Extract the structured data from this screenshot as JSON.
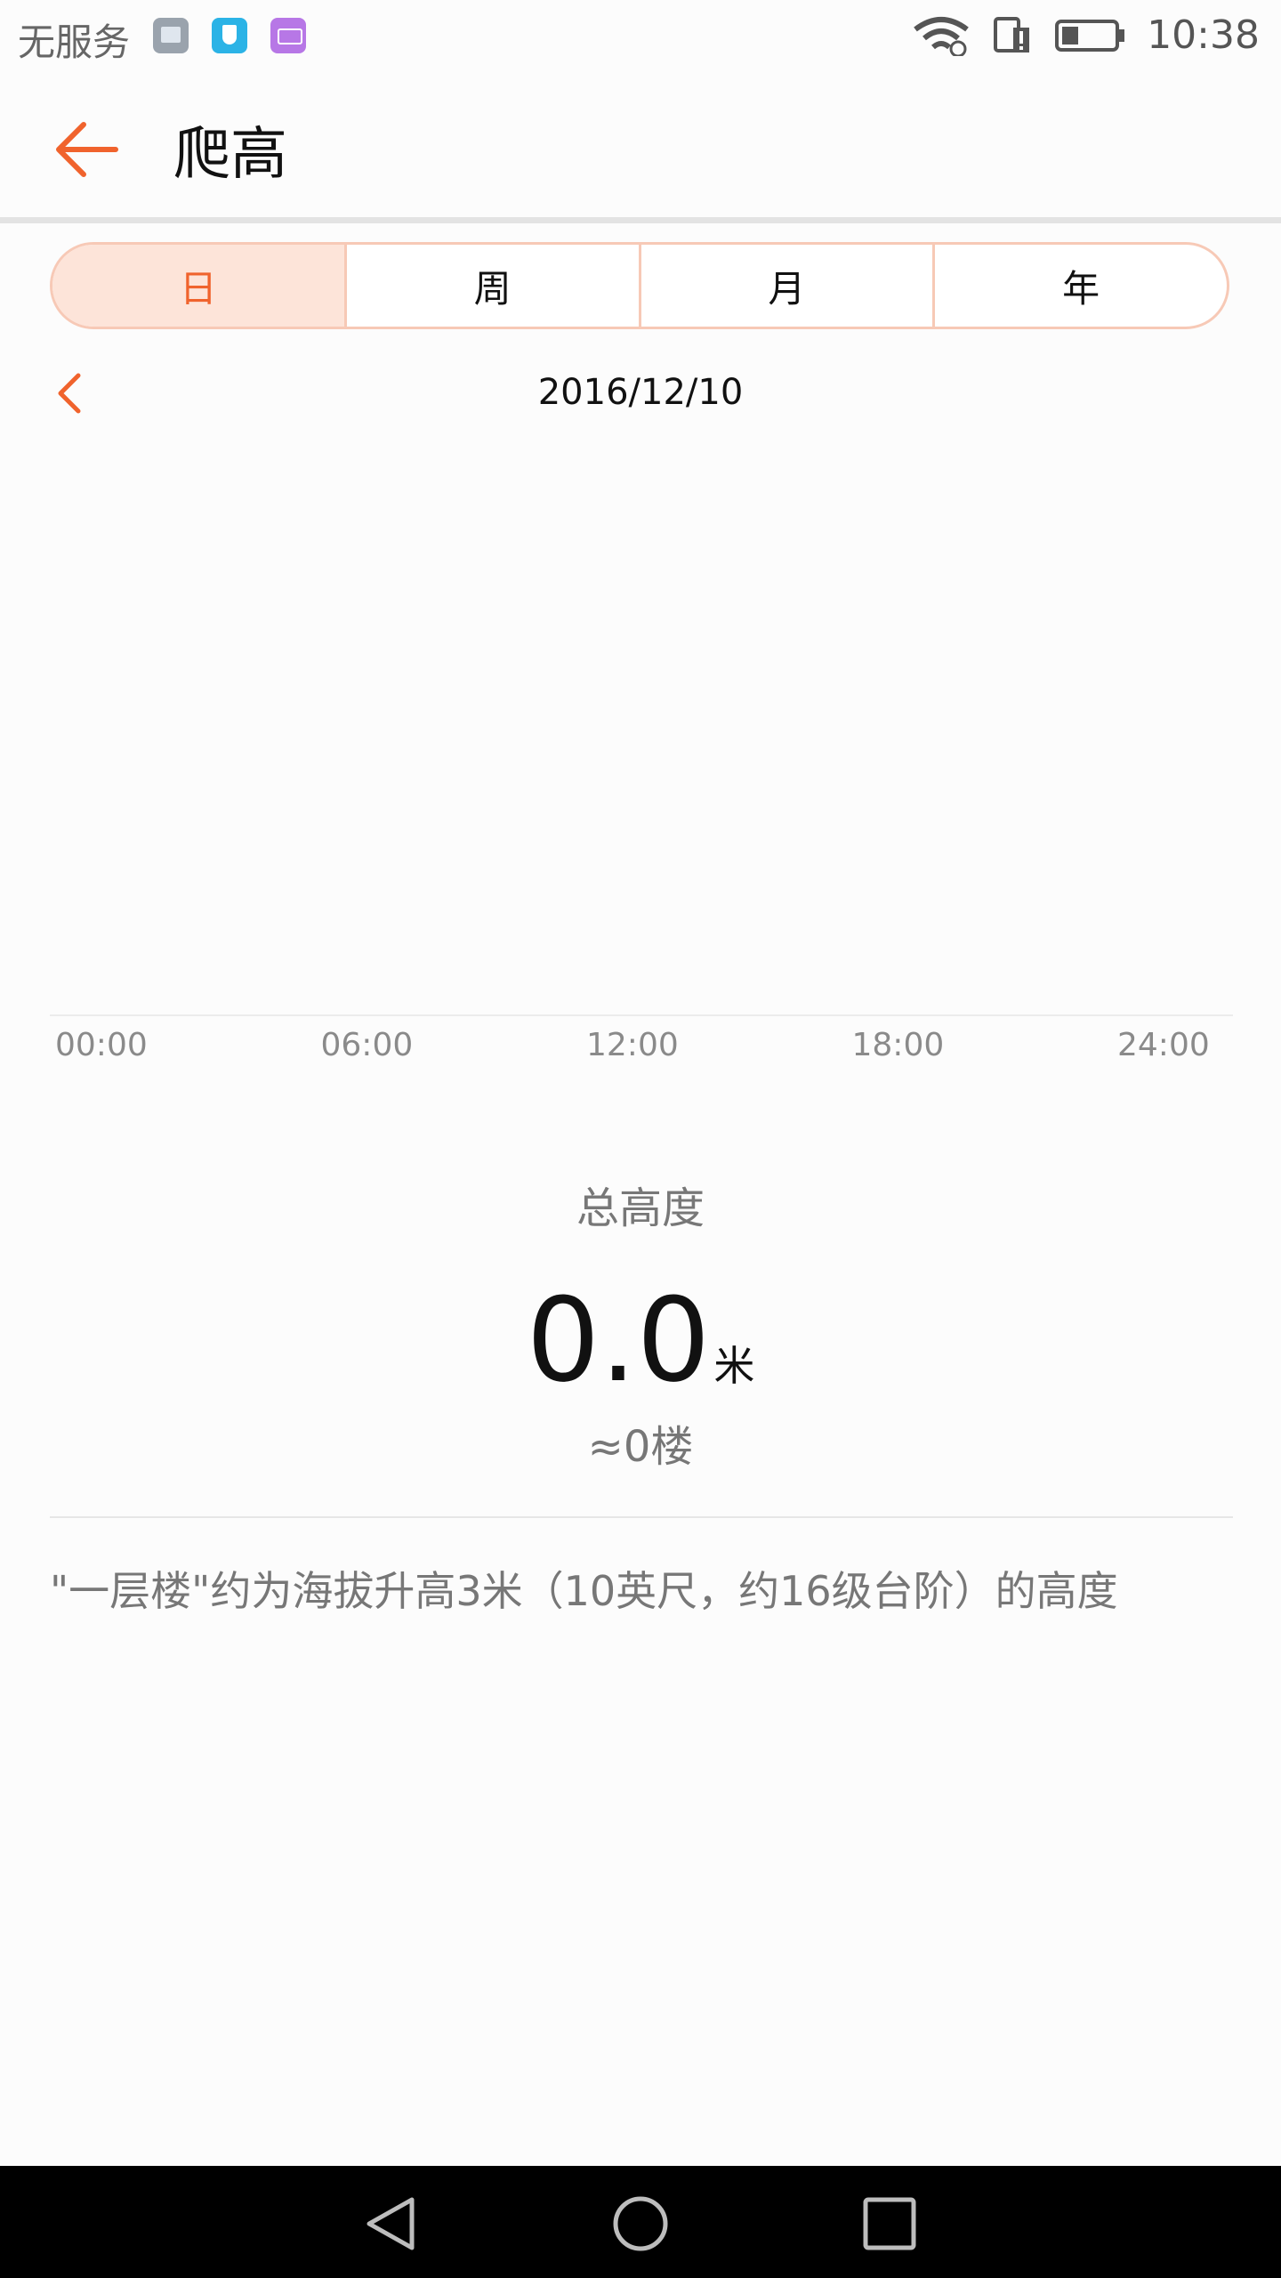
{
  "status_bar": {
    "carrier": "无服务",
    "time": "10:38",
    "icons": [
      "gallery-icon",
      "shield-icon",
      "keyboard-icon",
      "wifi-icon",
      "sim-alert-icon",
      "battery-icon"
    ]
  },
  "app_bar": {
    "title": "爬高",
    "back_icon": "arrow-left-icon"
  },
  "period_tabs": {
    "items": [
      {
        "label": "日",
        "active": true
      },
      {
        "label": "周",
        "active": false
      },
      {
        "label": "月",
        "active": false
      },
      {
        "label": "年",
        "active": false
      }
    ]
  },
  "date_nav": {
    "date": "2016/12/10",
    "prev_icon": "chevron-left-icon"
  },
  "chart_data": {
    "type": "bar",
    "categories": [
      "00:00",
      "06:00",
      "12:00",
      "18:00",
      "24:00"
    ],
    "values": [
      0,
      0,
      0,
      0,
      0
    ],
    "title": "",
    "xlabel": "",
    "ylabel": ""
  },
  "summary": {
    "label": "总高度",
    "value": "0.0",
    "unit": "米",
    "floors": "≈0楼"
  },
  "note": "\"一层楼\"约为海拔升高3米（10英尺，约16级台阶）的高度",
  "colors": {
    "accent": "#f0632d",
    "tab_active_bg": "#fde4d9",
    "tab_border": "#f7c9b6"
  },
  "nav_bar": {
    "icons": [
      "nav-back-icon",
      "nav-home-icon",
      "nav-recents-icon"
    ]
  }
}
